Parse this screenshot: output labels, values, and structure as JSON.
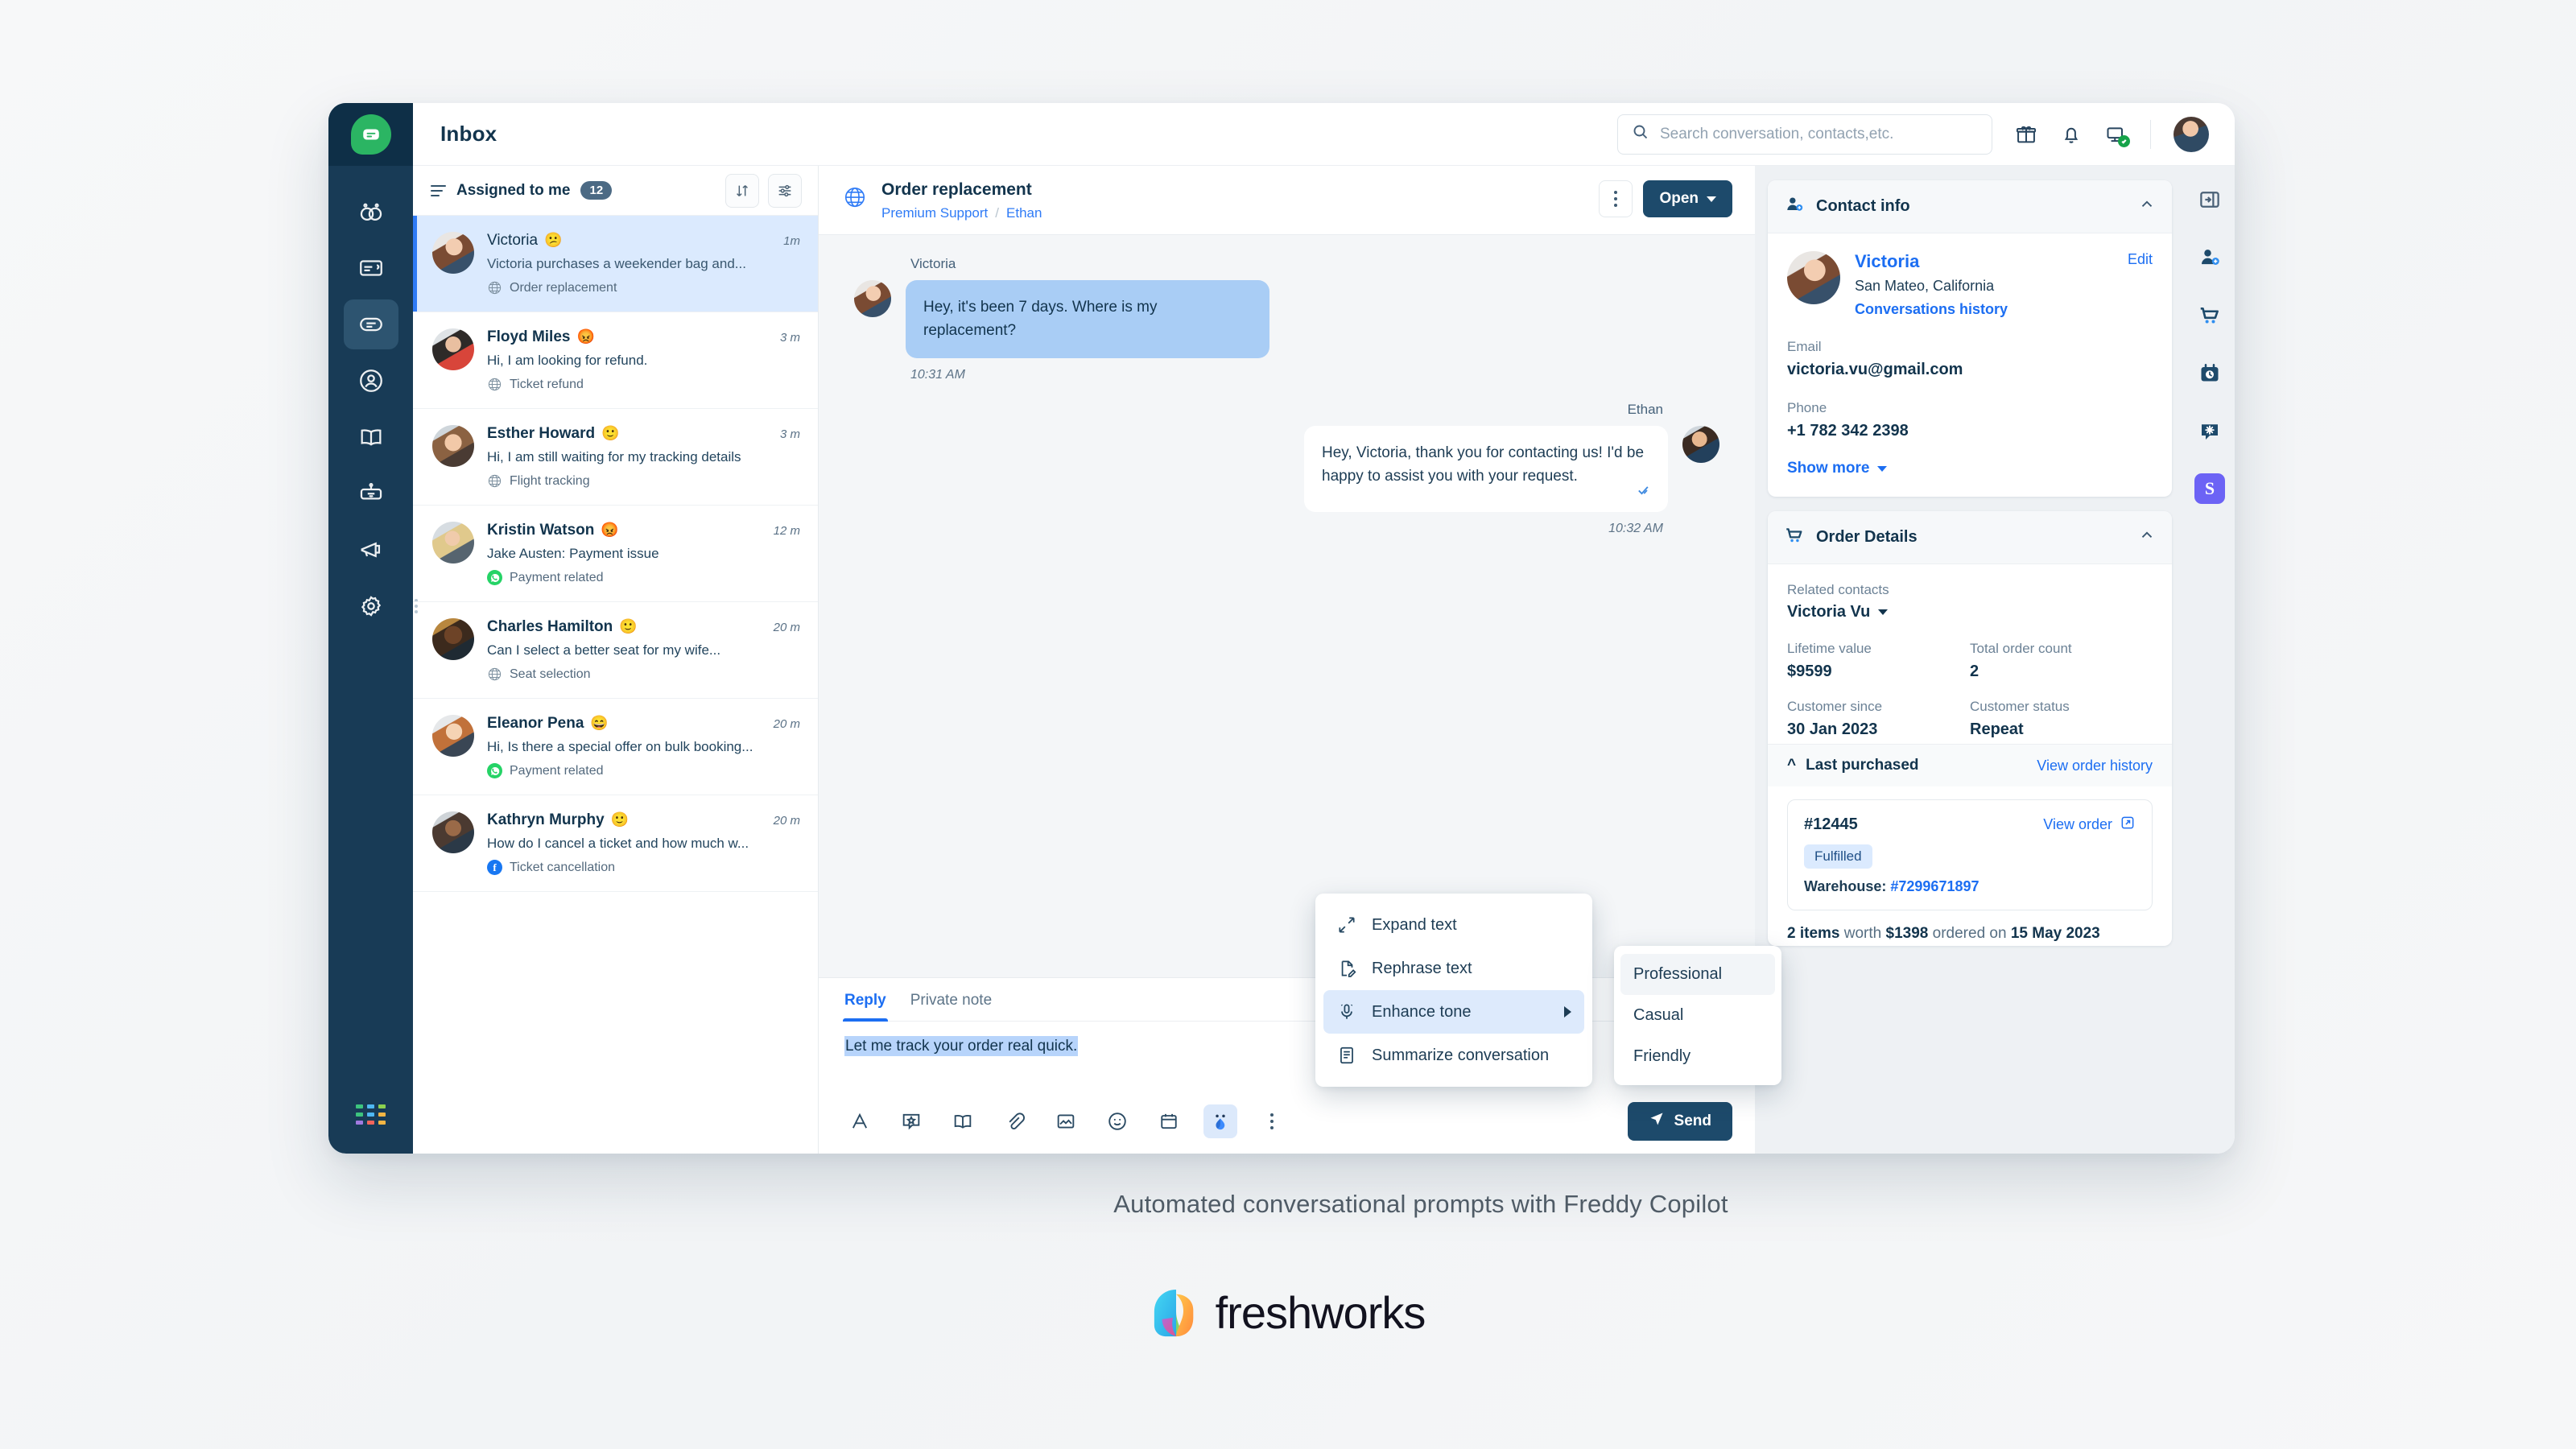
{
  "window": {
    "page_title": "Inbox",
    "search": {
      "placeholder": "Search conversation, contacts,etc."
    }
  },
  "nav_rail": {
    "logo": "freshchat-logo",
    "items": [
      {
        "name": "dashboard-icon"
      },
      {
        "name": "tickets-icon"
      },
      {
        "name": "conversations-icon"
      },
      {
        "name": "contacts-icon"
      },
      {
        "name": "knowledge-base-icon"
      },
      {
        "name": "bot-icon"
      },
      {
        "name": "campaigns-icon"
      },
      {
        "name": "settings-icon"
      }
    ]
  },
  "conversation_list": {
    "header": {
      "title": "Assigned to me",
      "count": "12"
    },
    "items": [
      {
        "name": "Victoria",
        "emoji": "😕",
        "time": "1m",
        "preview": "Victoria purchases a weekender bag and...",
        "channel": "globe",
        "channel_label": "Order replacement",
        "selected": true
      },
      {
        "name": "Floyd Miles",
        "emoji": "😡",
        "time": "3 m",
        "preview": "Hi, I am looking for refund.",
        "channel": "globe",
        "channel_label": "Ticket refund",
        "selected": false
      },
      {
        "name": "Esther Howard",
        "emoji": "🙂",
        "time": "3 m",
        "preview": "Hi, I am still waiting for my tracking details",
        "channel": "globe",
        "channel_label": "Flight tracking",
        "selected": false
      },
      {
        "name": "Kristin Watson",
        "emoji": "😡",
        "time": "12 m",
        "preview": "Jake Austen: Payment issue",
        "channel": "whatsapp",
        "channel_label": "Payment related",
        "selected": false
      },
      {
        "name": "Charles Hamilton",
        "emoji": "🙂",
        "time": "20 m",
        "preview": "Can I select a better seat for my wife...",
        "channel": "globe",
        "channel_label": "Seat selection",
        "selected": false
      },
      {
        "name": "Eleanor Pena",
        "emoji": "😄",
        "time": "20 m",
        "preview": "Hi, Is there a special offer on bulk booking...",
        "channel": "whatsapp",
        "channel_label": "Payment related",
        "selected": false
      },
      {
        "name": "Kathryn Murphy",
        "emoji": "🙂",
        "time": "20 m",
        "preview": "How do I cancel a ticket and how much w...",
        "channel": "facebook",
        "channel_label": "Ticket cancellation",
        "selected": false
      }
    ]
  },
  "conversation": {
    "title": "Order replacement",
    "breadcrumb": {
      "group": "Premium Support",
      "agent": "Ethan"
    },
    "status_button": "Open",
    "messages": [
      {
        "sender": "Victoria",
        "text": "Hey, it's been 7 days. Where is my replacement?",
        "time": "10:31 AM",
        "direction": "in"
      },
      {
        "sender": "Ethan",
        "text": "Hey, Victoria, thank you for contacting us! I'd be happy to assist you with your request.",
        "time": "10:32 AM",
        "direction": "out"
      }
    ]
  },
  "composer": {
    "tabs": [
      {
        "label": "Reply",
        "active": true
      },
      {
        "label": "Private note",
        "active": false
      }
    ],
    "draft_text": "Let me track your order real quick.",
    "send_label": "Send",
    "tools": [
      "format-text-icon",
      "canned-response-icon",
      "knowledge-base-icon",
      "attachment-icon",
      "image-icon",
      "emoji-icon",
      "calendar-icon",
      "freddy-copilot-icon",
      "more-options-icon"
    ]
  },
  "freddy_menu": {
    "items": [
      {
        "label": "Expand text",
        "icon": "expand-text-icon",
        "active": false,
        "submenu": false
      },
      {
        "label": "Rephrase text",
        "icon": "rephrase-text-icon",
        "active": false,
        "submenu": false
      },
      {
        "label": "Enhance tone",
        "icon": "enhance-tone-icon",
        "active": true,
        "submenu": true
      },
      {
        "label": "Summarize conversation",
        "icon": "summarize-icon",
        "active": false,
        "submenu": false
      }
    ],
    "tone_options": [
      {
        "label": "Professional",
        "hover": true
      },
      {
        "label": "Casual",
        "hover": false
      },
      {
        "label": "Friendly",
        "hover": false
      }
    ]
  },
  "contact_info": {
    "title": "Contact info",
    "name": "Victoria",
    "location": "San Mateo, California",
    "history_link": "Conversations history",
    "edit_label": "Edit",
    "email_label": "Email",
    "email": "victoria.vu@gmail.com",
    "phone_label": "Phone",
    "phone": "+1 782 342 2398",
    "show_more": "Show more"
  },
  "order_details": {
    "title": "Order Details",
    "related_contacts_label": "Related contacts",
    "related_contact": "Victoria Vu",
    "stats": [
      {
        "label": "Lifetime value",
        "value": "$9599"
      },
      {
        "label": "Total order count",
        "value": "2"
      },
      {
        "label": "Customer since",
        "value": "30 Jan 2023"
      },
      {
        "label": "Customer status",
        "value": "Repeat"
      }
    ],
    "last_purchased_title": "Last purchased",
    "view_order_history": "View order history",
    "order": {
      "id": "#12445",
      "view_order": "View order",
      "status": "Fulfilled",
      "warehouse_label": "Warehouse:",
      "warehouse_id": "#7299671897"
    },
    "summary": {
      "items": "2 items",
      "worth_word": "worth",
      "amount": "$1398",
      "ordered_word": "ordered on",
      "date": "15 May 2023"
    }
  },
  "right_rail": {
    "items": [
      {
        "name": "collapse-panel-icon"
      },
      {
        "name": "contact-info-icon"
      },
      {
        "name": "order-cart-icon"
      },
      {
        "name": "schedule-icon"
      },
      {
        "name": "chat-settings-icon"
      },
      {
        "name": "stripe-app-icon",
        "label": "S"
      }
    ]
  },
  "caption": "Automated conversational prompts with Freddy Copilot",
  "brand": {
    "name": "freshworks"
  },
  "colors": {
    "nav_bg": "#183b56",
    "accent_blue": "#1c6ef2",
    "logo_green": "#2bb563",
    "selected_row": "#dbeafe",
    "primary_button": "#1d4a6b"
  }
}
